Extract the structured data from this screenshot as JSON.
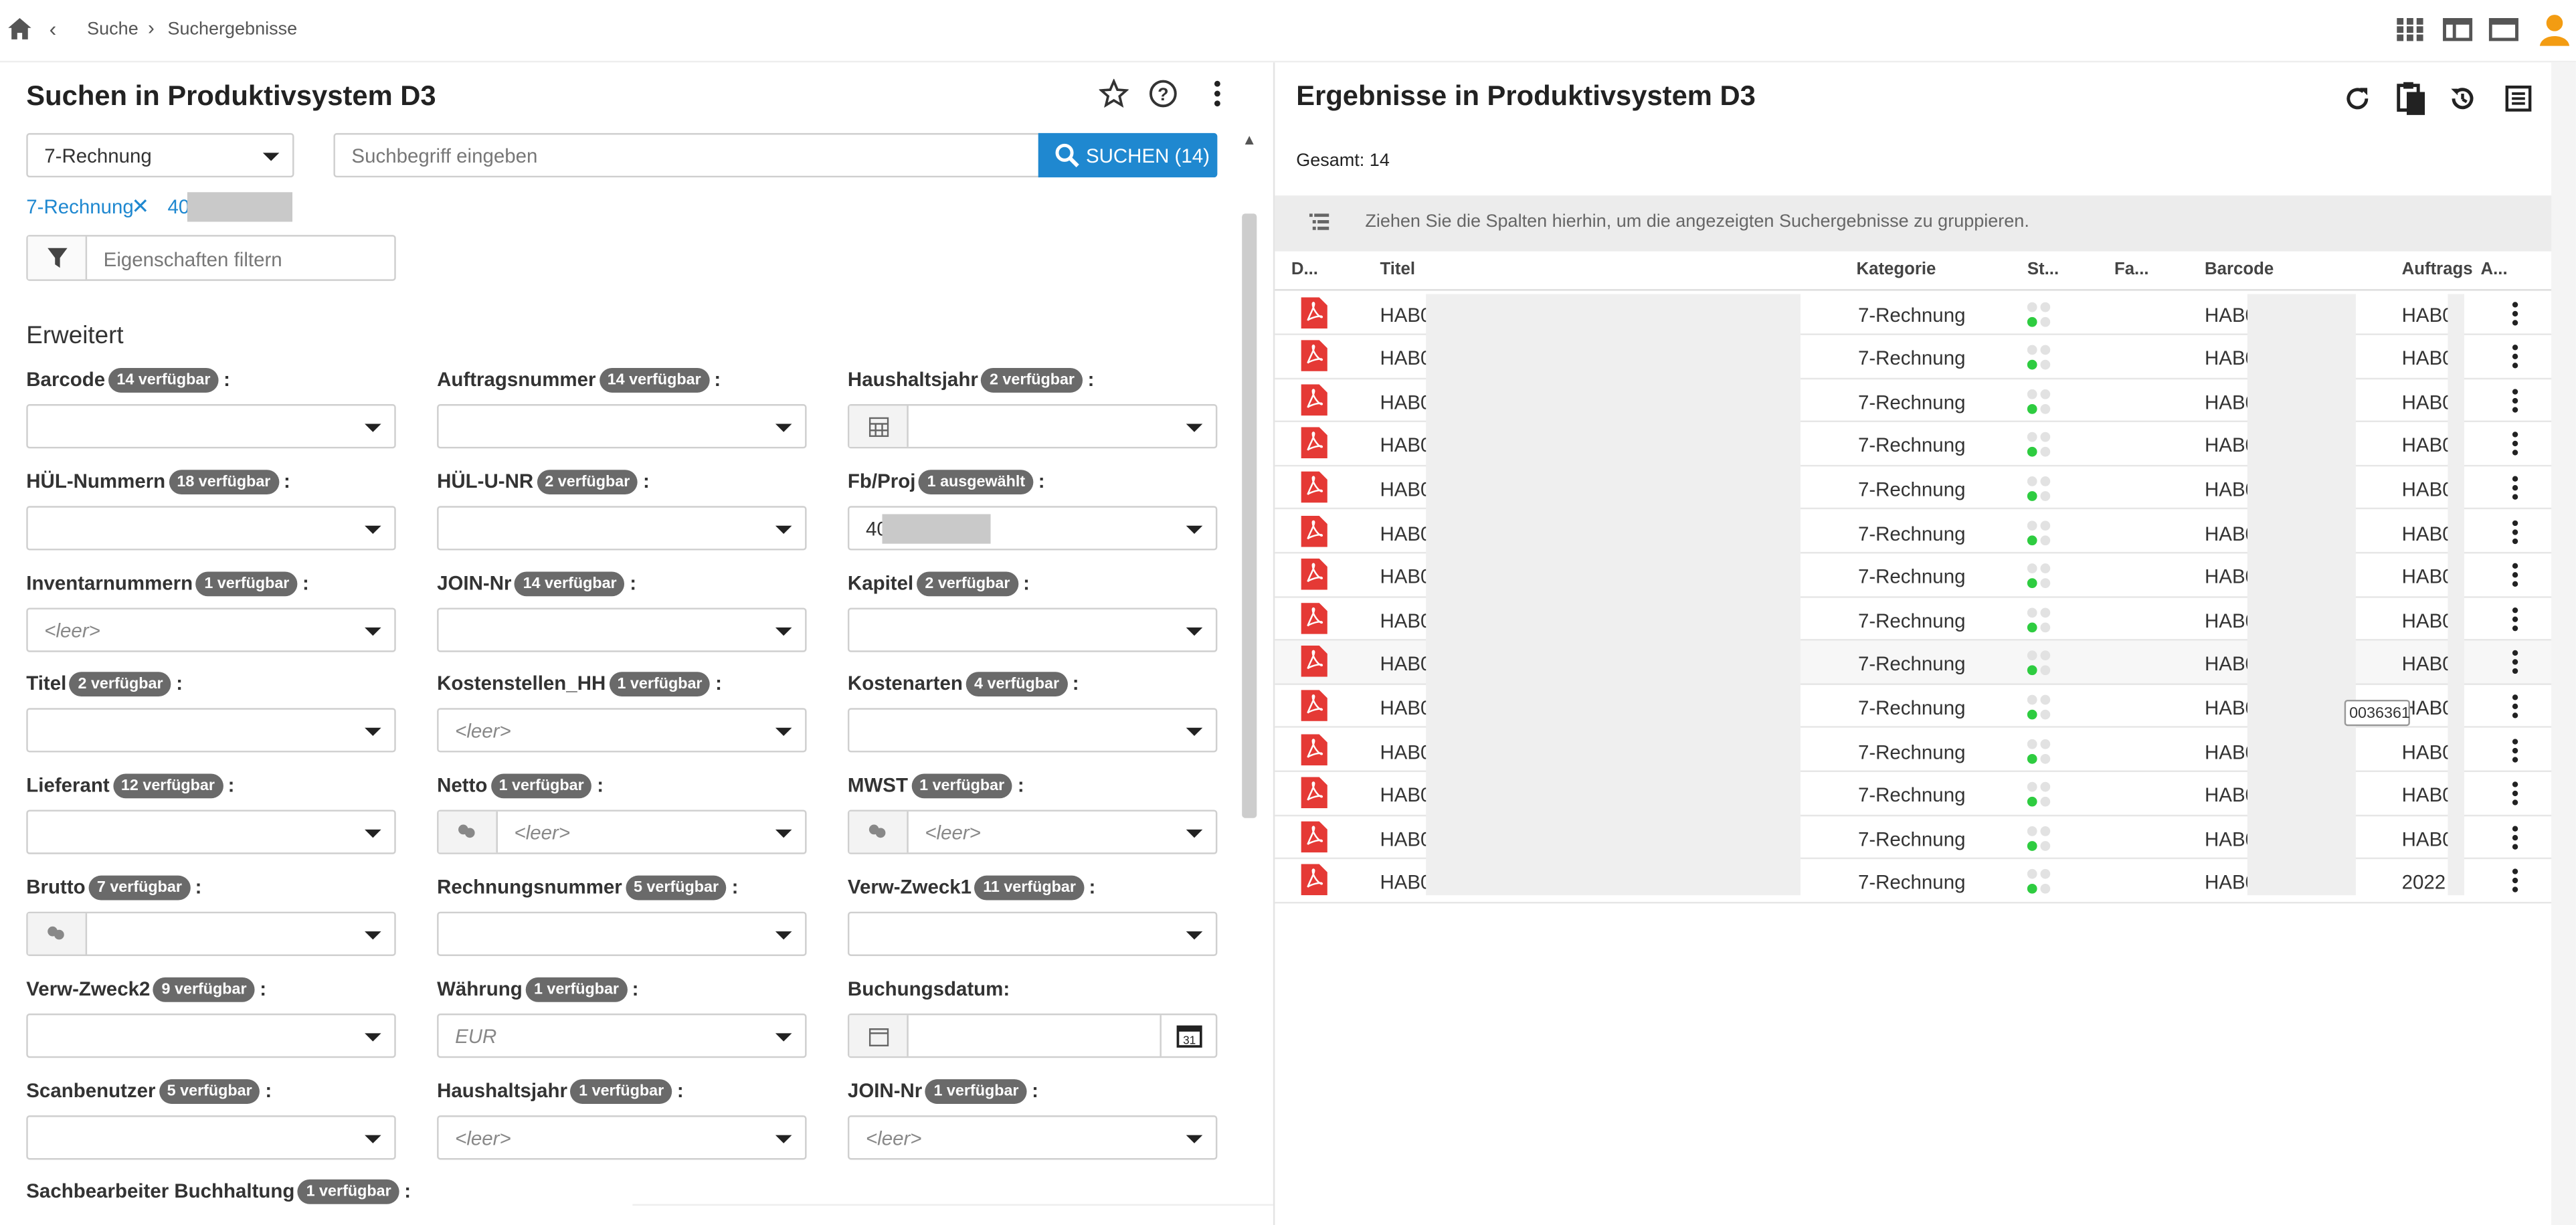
{
  "breadcrumb": {
    "back": "‹",
    "items": [
      "Suche",
      "Suchergebnisse"
    ],
    "separator": "›"
  },
  "topbar_icons": [
    "apps-grid-icon",
    "split-layout-icon",
    "single-layout-icon",
    "user-avatar-icon"
  ],
  "left": {
    "title": "Suchen in  Produktivsystem D3",
    "category_select": "7-Rechnung",
    "search_placeholder": "Suchbegriff eingeben",
    "search_button": "SUCHEN (14)",
    "chips": {
      "category": "7-Rechnung",
      "remove": "✕",
      "fbproj": "40"
    },
    "filter_placeholder": "Eigenschaften filtern",
    "section": "Erweitert",
    "fields": [
      {
        "label": "Barcode",
        "badge": "14 verfügbar",
        "value": "",
        "placeholder": ""
      },
      {
        "label": "Auftragsnummer",
        "badge": "14 verfügbar",
        "value": "",
        "placeholder": ""
      },
      {
        "label": "Haushaltsjahr",
        "badge": "2 verfügbar",
        "value": "",
        "placeholder": ""
      },
      {
        "label": "HÜL-Nummern",
        "badge": "18 verfügbar",
        "value": "",
        "placeholder": ""
      },
      {
        "label": "HÜL-U-NR",
        "badge": "2 verfügbar",
        "value": "",
        "placeholder": ""
      },
      {
        "label": "Fb/Proj",
        "badge": "1 ausgewählt",
        "value": "40",
        "placeholder": ""
      },
      {
        "label": "Inventarnummern",
        "badge": "1 verfügbar",
        "value": "",
        "placeholder": "<leer>"
      },
      {
        "label": "JOIN-Nr",
        "badge": "14 verfügbar",
        "value": "",
        "placeholder": ""
      },
      {
        "label": "Kapitel",
        "badge": "2 verfügbar",
        "value": "",
        "placeholder": ""
      },
      {
        "label": "Titel",
        "badge": "2 verfügbar",
        "value": "",
        "placeholder": ""
      },
      {
        "label": "Kostenstellen_HH",
        "badge": "1 verfügbar",
        "value": "",
        "placeholder": "<leer>"
      },
      {
        "label": "Kostenarten",
        "badge": "4 verfügbar",
        "value": "",
        "placeholder": ""
      },
      {
        "label": "Lieferant",
        "badge": "12 verfügbar",
        "value": "",
        "placeholder": ""
      },
      {
        "label": "Netto",
        "badge": "1 verfügbar",
        "value": "",
        "placeholder": "<leer>"
      },
      {
        "label": "MWST",
        "badge": "1 verfügbar",
        "value": "",
        "placeholder": "<leer>"
      },
      {
        "label": "Brutto",
        "badge": "7 verfügbar",
        "value": "",
        "placeholder": ""
      },
      {
        "label": "Rechnungsnummer",
        "badge": "5 verfügbar",
        "value": "",
        "placeholder": ""
      },
      {
        "label": "Verw-Zweck1",
        "badge": "11 verfügbar",
        "value": "",
        "placeholder": ""
      },
      {
        "label": "Verw-Zweck2",
        "badge": "9 verfügbar",
        "value": "",
        "placeholder": ""
      },
      {
        "label": "Währung",
        "badge": "1 verfügbar",
        "value": "",
        "placeholder": "EUR"
      },
      {
        "label": "Buchungsdatum:",
        "badge": "",
        "value": "",
        "placeholder": ""
      },
      {
        "label": "Scanbenutzer",
        "badge": "5 verfügbar",
        "value": "",
        "placeholder": ""
      },
      {
        "label": "Haushaltsjahr",
        "badge": "1 verfügbar",
        "value": "",
        "placeholder": "<leer>"
      },
      {
        "label": "JOIN-Nr",
        "badge": "1 verfügbar",
        "value": "",
        "placeholder": "<leer>"
      },
      {
        "label": "Sachbearbeiter Buchhaltung",
        "badge": "1 verfügbar",
        "value": "",
        "placeholder": ""
      }
    ],
    "colon": ":"
  },
  "right": {
    "title": "Ergebnisse in Produktivsystem D3",
    "total": "Gesamt: 14",
    "group_hint": "Ziehen Sie die Spalten hierhin, um die angezeigten Suchergebnisse zu gruppieren.",
    "columns": [
      "D...",
      "Titel",
      "Kategorie",
      "St...",
      "Fa...",
      "Barcode",
      "Auftrags",
      "A..."
    ],
    "rows": [
      {
        "titel": "HAB0",
        "kategorie": "7-Rechnung",
        "barcode": "HAB0",
        "auftrag": "HAB0"
      },
      {
        "titel": "HAB0",
        "kategorie": "7-Rechnung",
        "barcode": "HAB0",
        "auftrag": "HAB0"
      },
      {
        "titel": "HAB0",
        "kategorie": "7-Rechnung",
        "barcode": "HAB0",
        "auftrag": "HAB0"
      },
      {
        "titel": "HAB0",
        "kategorie": "7-Rechnung",
        "barcode": "HAB0",
        "auftrag": "HAB0"
      },
      {
        "titel": "HAB0",
        "kategorie": "7-Rechnung",
        "barcode": "HAB0",
        "auftrag": "HAB0"
      },
      {
        "titel": "HAB0",
        "kategorie": "7-Rechnung",
        "barcode": "HAB0",
        "auftrag": "HAB0"
      },
      {
        "titel": "HAB0",
        "kategorie": "7-Rechnung",
        "barcode": "HAB0",
        "auftrag": "HAB0"
      },
      {
        "titel": "HAB0",
        "kategorie": "7-Rechnung",
        "barcode": "HAB0",
        "auftrag": "HAB0"
      },
      {
        "titel": "HAB0",
        "kategorie": "7-Rechnung",
        "barcode": "HAB0",
        "auftrag": "HAB0"
      },
      {
        "titel": "HAB0",
        "kategorie": "7-Rechnung",
        "barcode": "HAB0",
        "auftrag": "HAB0"
      },
      {
        "titel": "HAB0",
        "kategorie": "7-Rechnung",
        "barcode": "HAB0",
        "auftrag": "HAB0"
      },
      {
        "titel": "HAB0",
        "kategorie": "7-Rechnung",
        "barcode": "HAB0",
        "auftrag": "HAB0"
      },
      {
        "titel": "HAB0",
        "kategorie": "7-Rechnung",
        "barcode": "HAB0",
        "auftrag": "HAB0"
      },
      {
        "titel": "HAB0",
        "kategorie": "7-Rechnung",
        "barcode": "HAB0",
        "auftrag": "2022"
      }
    ],
    "tooltip": "0036361",
    "colors": {
      "accent": "#1f88d0",
      "pdf": "#e53935",
      "status_green": "#2ecc40",
      "badge": "#6a6a6a",
      "avatar": "#f39c12"
    }
  }
}
